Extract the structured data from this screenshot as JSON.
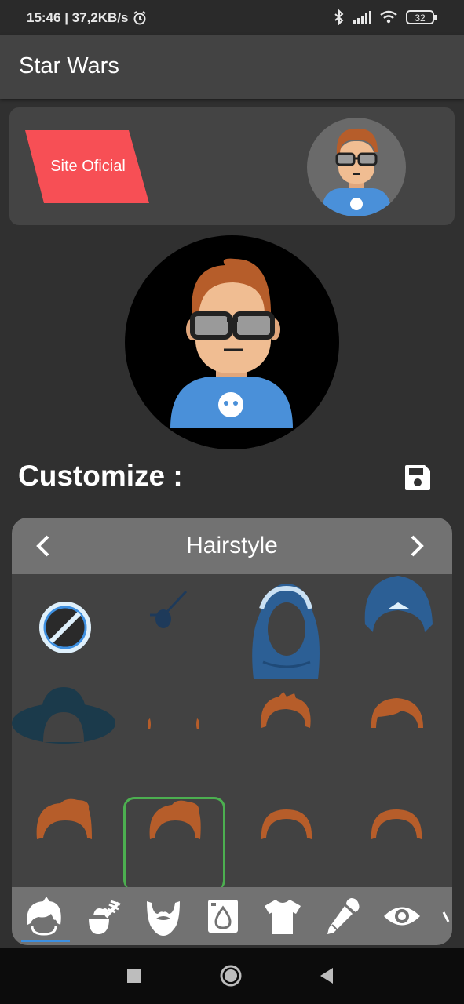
{
  "status_bar": {
    "time_info": "15:46 | 37,2KB/s",
    "battery": "32"
  },
  "app_bar": {
    "title": "Star Wars"
  },
  "header_card": {
    "site_button_label": "Site Oficial"
  },
  "customize": {
    "title": "Customize :"
  },
  "panel": {
    "title": "Hairstyle",
    "items": [
      {
        "name": "none-icon"
      },
      {
        "name": "eyepatch"
      },
      {
        "name": "hijab"
      },
      {
        "name": "turban"
      },
      {
        "name": "wide-hat"
      },
      {
        "name": "short-hair-sides"
      },
      {
        "name": "spiky-hair"
      },
      {
        "name": "side-part-hair"
      },
      {
        "name": "quiff-hair"
      },
      {
        "name": "quiff-hair-selected"
      },
      {
        "name": "round-hair"
      },
      {
        "name": "round-hair-2"
      }
    ],
    "selected_index": 9
  },
  "bottom_tabs": [
    {
      "name": "tab-hair"
    },
    {
      "name": "tab-hair-color"
    },
    {
      "name": "tab-beard"
    },
    {
      "name": "tab-skin"
    },
    {
      "name": "tab-clothes"
    },
    {
      "name": "tab-clothes-color"
    },
    {
      "name": "tab-eyes"
    }
  ],
  "colors": {
    "accent_red": "#f74f55",
    "shirt_blue": "#4a90d9",
    "hair_orange": "#b65d2a",
    "selected_green": "#4caf50",
    "indicator_blue": "#3d8fe0"
  }
}
